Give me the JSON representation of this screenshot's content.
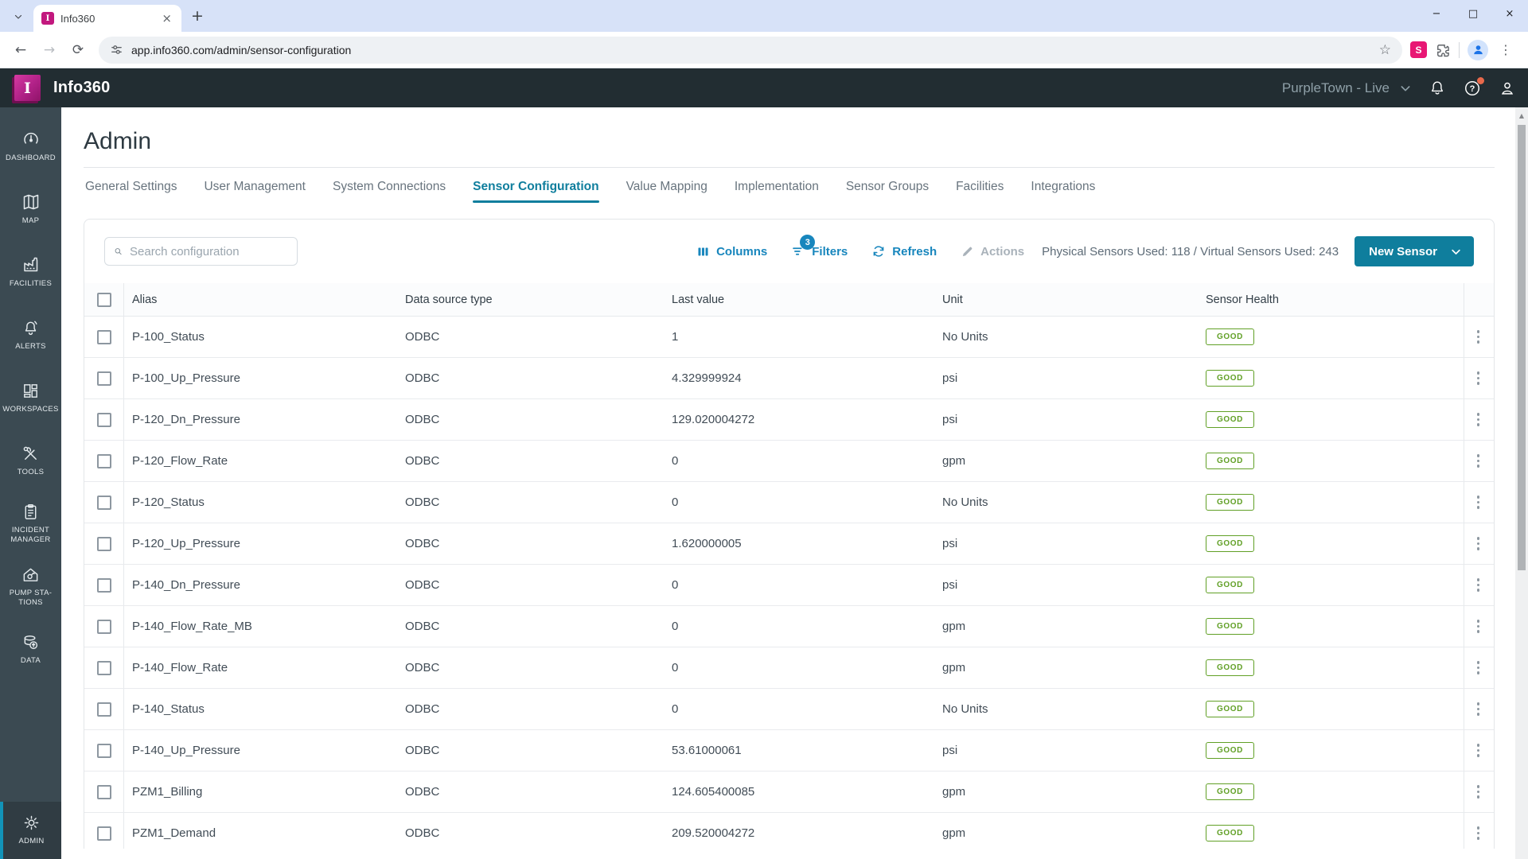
{
  "colors": {
    "accent_teal": "#0F7E9D",
    "link_blue": "#1886BD",
    "good_green": "#61A026",
    "brand_magenta": "#C2187E",
    "header_dark": "#222D32",
    "sidebar_dark": "#3B4A52"
  },
  "browser": {
    "tab": {
      "title": "Info360",
      "favicon_letter": "I",
      "close_icon": "×"
    },
    "tab_strip": {
      "new_tab_icon": "+"
    },
    "window_controls": {
      "minimize": "−",
      "maximize": "□",
      "close": "×"
    },
    "nav": {
      "back": "←",
      "forward": "→",
      "reload": "⟳"
    },
    "url": "app.info360.com/admin/sensor-configuration",
    "star_icon": "☆",
    "extension_letter": "S",
    "menu_icon": "⋮",
    "scroll_up_icon": "▲"
  },
  "header": {
    "logo_letter": "I",
    "app_name": "Info360",
    "environment": "PurpleTown - Live"
  },
  "sidebar": {
    "items": [
      {
        "label": "DASHBOARD"
      },
      {
        "label": "MAP"
      },
      {
        "label": "FACILITIES"
      },
      {
        "label": "ALERTS"
      },
      {
        "label": "WORKSPACES"
      },
      {
        "label": "TOOLS"
      },
      {
        "label": "INCIDENT MANAGER"
      },
      {
        "label": "PUMP STA-TIONS"
      },
      {
        "label": "DATA"
      }
    ],
    "admin": {
      "label": "ADMIN"
    }
  },
  "page": {
    "title": "Admin",
    "tabs": [
      {
        "label": "General Settings"
      },
      {
        "label": "User Management"
      },
      {
        "label": "System Connections"
      },
      {
        "label": "Sensor Configuration",
        "active": true
      },
      {
        "label": "Value Mapping"
      },
      {
        "label": "Implementation"
      },
      {
        "label": "Sensor Groups"
      },
      {
        "label": "Facilities"
      },
      {
        "label": "Integrations"
      }
    ],
    "toolbar": {
      "search_placeholder": "Search configuration",
      "columns_label": "Columns",
      "filters_label": "Filters",
      "filters_badge": "3",
      "refresh_label": "Refresh",
      "actions_label": "Actions",
      "usage_text": "Physical Sensors Used: 118 / Virtual Sensors Used: 243",
      "new_sensor_label": "New Sensor"
    },
    "table": {
      "columns": [
        "Alias",
        "Data source type",
        "Last value",
        "Unit",
        "Sensor Health"
      ],
      "rows": [
        {
          "alias": "P-100_Status",
          "source": "ODBC",
          "value": "1",
          "unit": "No Units",
          "health": "GOOD"
        },
        {
          "alias": "P-100_Up_Pressure",
          "source": "ODBC",
          "value": "4.329999924",
          "unit": "psi",
          "health": "GOOD"
        },
        {
          "alias": "P-120_Dn_Pressure",
          "source": "ODBC",
          "value": "129.020004272",
          "unit": "psi",
          "health": "GOOD"
        },
        {
          "alias": "P-120_Flow_Rate",
          "source": "ODBC",
          "value": "0",
          "unit": "gpm",
          "health": "GOOD"
        },
        {
          "alias": "P-120_Status",
          "source": "ODBC",
          "value": "0",
          "unit": "No Units",
          "health": "GOOD"
        },
        {
          "alias": "P-120_Up_Pressure",
          "source": "ODBC",
          "value": "1.620000005",
          "unit": "psi",
          "health": "GOOD"
        },
        {
          "alias": "P-140_Dn_Pressure",
          "source": "ODBC",
          "value": "0",
          "unit": "psi",
          "health": "GOOD"
        },
        {
          "alias": "P-140_Flow_Rate_MB",
          "source": "ODBC",
          "value": "0",
          "unit": "gpm",
          "health": "GOOD"
        },
        {
          "alias": "P-140_Flow_Rate",
          "source": "ODBC",
          "value": "0",
          "unit": "gpm",
          "health": "GOOD"
        },
        {
          "alias": "P-140_Status",
          "source": "ODBC",
          "value": "0",
          "unit": "No Units",
          "health": "GOOD"
        },
        {
          "alias": "P-140_Up_Pressure",
          "source": "ODBC",
          "value": "53.61000061",
          "unit": "psi",
          "health": "GOOD"
        },
        {
          "alias": "PZM1_Billing",
          "source": "ODBC",
          "value": "124.605400085",
          "unit": "gpm",
          "health": "GOOD"
        },
        {
          "alias": "PZM1_Demand",
          "source": "ODBC",
          "value": "209.520004272",
          "unit": "gpm",
          "health": "GOOD"
        }
      ]
    }
  }
}
